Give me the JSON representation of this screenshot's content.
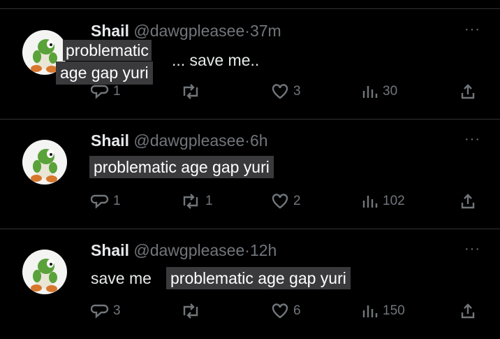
{
  "colors": {
    "background": "#000000",
    "text": "#e7e9ea",
    "muted": "#71767b",
    "divider": "#2f3336",
    "caption_bg": "#3a3a3d"
  },
  "tweets": [
    {
      "name": "Shail",
      "handle": "@dawgpleasee",
      "sep": "·",
      "time": "37m",
      "text_prefix": "",
      "text": "... save me..",
      "caption_lines": [
        "problematic",
        "age gap yuri"
      ],
      "actions": {
        "reply": "1",
        "retweet": "",
        "like": "3",
        "views": "30"
      }
    },
    {
      "name": "Shail",
      "handle": "@dawgpleasee",
      "sep": "·",
      "time": "6h",
      "text_prefix": "",
      "text": "",
      "caption_lines": [
        "problematic age gap yuri"
      ],
      "actions": {
        "reply": "1",
        "retweet": "1",
        "like": "2",
        "views": "102"
      }
    },
    {
      "name": "Shail",
      "handle": "@dawgpleasee",
      "sep": "·",
      "time": "12h",
      "text_prefix": "save me",
      "text": "",
      "caption_lines": [
        "problematic age gap yuri"
      ],
      "actions": {
        "reply": "3",
        "retweet": "",
        "like": "6",
        "views": "150"
      }
    }
  ],
  "icons": {
    "avatar": "yoshi-figure-avatar",
    "more": "more-dots-icon",
    "reply": "reply-bubble-icon",
    "retweet": "retweet-icon",
    "like": "heart-icon",
    "views": "views-bar-chart-icon",
    "share": "share-upload-icon"
  },
  "more_glyph": "···"
}
